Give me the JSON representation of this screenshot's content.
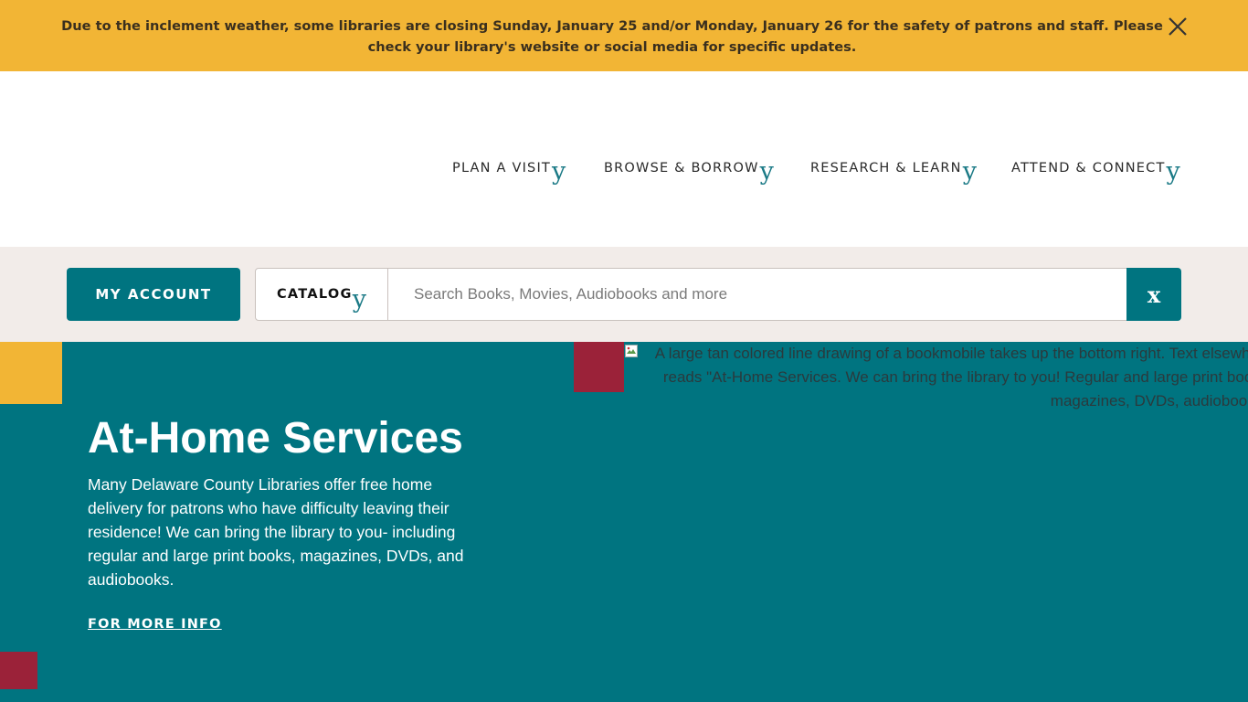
{
  "alert": {
    "message": "Due to the inclement weather, some libraries are closing Sunday, January 25 and/or Monday, January 26 for the safety of patrons and staff. Please check your library's website or social media for specific updates.",
    "close_icon": "close-x-icon"
  },
  "nav": {
    "items": [
      {
        "label": "PLAN A VISIT",
        "accent": "y"
      },
      {
        "label": "BROWSE & BORROW",
        "accent": "y"
      },
      {
        "label": "RESEARCH & LEARN",
        "accent": "y"
      },
      {
        "label": "ATTEND & CONNECT",
        "accent": "y"
      }
    ]
  },
  "search": {
    "account_label": "MY ACCOUNT",
    "scope_label": "CATALOG",
    "scope_accent": "y",
    "placeholder": "Search Books, Movies, Audiobooks and more",
    "value": "",
    "submit_label": "x"
  },
  "hero": {
    "title": "At-Home Services",
    "body": "Many Delaware County Libraries offer free home delivery for patrons who have difficulty leaving their residence! We can bring the library to you- including regular and large print books, magazines, DVDs, and audiobooks.",
    "link_label": "FOR MORE INFO",
    "image_alt": "A large tan colored line drawing of a bookmobile takes up the bottom right. Text elsewhere reads \"At-Home Services. We can bring the library to you! Regular and large print books, magazines, DVDs, audiobooks.\""
  },
  "colors": {
    "alert_bg": "#f2b535",
    "teal": "#007480",
    "accent_teal": "#1b7a86",
    "crimson": "#9b2239",
    "search_band_bg": "#f2ece9"
  }
}
